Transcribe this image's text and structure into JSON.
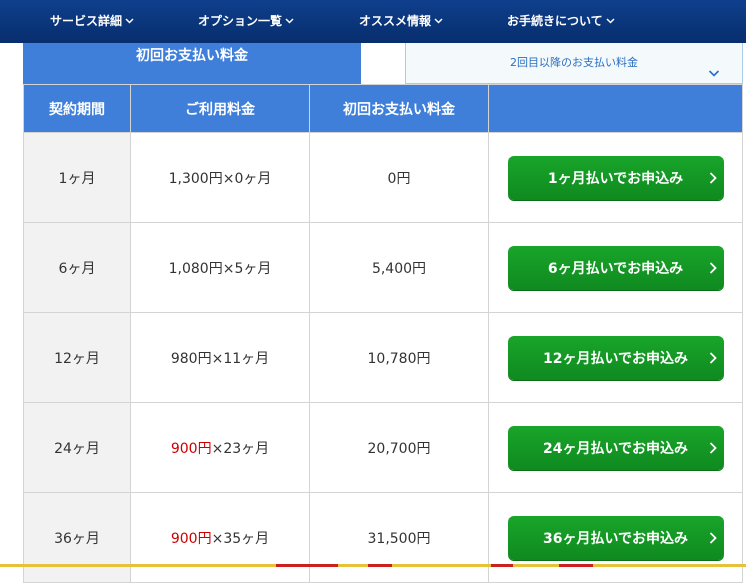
{
  "nav": {
    "items": [
      {
        "label": "サービス詳細"
      },
      {
        "label": "オプション一覧"
      },
      {
        "label": "オススメ情報"
      },
      {
        "label": "お手続きについて"
      }
    ]
  },
  "tabs": {
    "first_payment": "初回お支払い料金",
    "second_payment": "2回目以降のお支払い料金"
  },
  "table": {
    "headers": {
      "period": "契約期間",
      "usage_fee": "ご利用料金",
      "first_payment": "初回お支払い料金",
      "action": ""
    },
    "rows": [
      {
        "period": "1ヶ月",
        "fee_price": "1,300円",
        "fee_multiplier": "×0ヶ月",
        "fee_price_highlight": false,
        "first_payment": "0円",
        "button": "1ヶ月払いでお申込み"
      },
      {
        "period": "6ヶ月",
        "fee_price": "1,080円",
        "fee_multiplier": "×5ヶ月",
        "fee_price_highlight": false,
        "first_payment": "5,400円",
        "button": "6ヶ月払いでお申込み"
      },
      {
        "period": "12ヶ月",
        "fee_price": "980円",
        "fee_multiplier": "×11ヶ月",
        "fee_price_highlight": false,
        "first_payment": "10,780円",
        "button": "12ヶ月払いでお申込み"
      },
      {
        "period": "24ヶ月",
        "fee_price": "900円",
        "fee_multiplier": "×23ヶ月",
        "fee_price_highlight": true,
        "first_payment": "20,700円",
        "button": "24ヶ月払いでお申込み"
      },
      {
        "period": "36ヶ月",
        "fee_price": "900円",
        "fee_multiplier": "×35ヶ月",
        "fee_price_highlight": true,
        "first_payment": "31,500円",
        "button": "36ヶ月払いでお申込み"
      }
    ]
  },
  "colors": {
    "nav_bg": "#0b3a82",
    "header_blue": "#3f7fd9",
    "button_green": "#14992a",
    "highlight_red": "#cc0000"
  },
  "icons": {
    "nav_chevron": "chevron-down-icon",
    "tab_chevron": "chevron-down-icon",
    "button_arrow": "chevron-right-icon"
  }
}
